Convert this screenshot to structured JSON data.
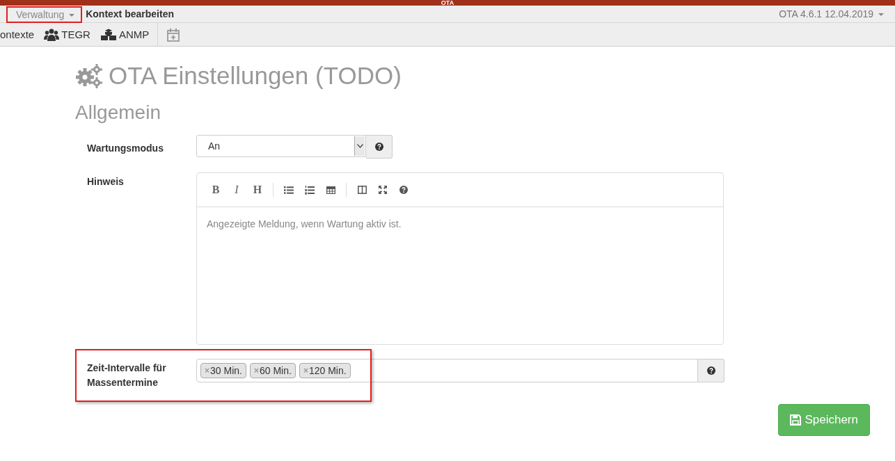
{
  "app_bar": {
    "title": "OTA"
  },
  "navbar": {
    "menu": "Verwaltung",
    "page_title": "Kontext bearbeiten",
    "version": "OTA 4.6.1 12.04.2019"
  },
  "toolbar": {
    "items": [
      {
        "kind": "text",
        "label": "ontexte"
      },
      {
        "kind": "users",
        "label": "TEGR"
      },
      {
        "kind": "cubes",
        "label": "ANMP"
      },
      {
        "kind": "calendar"
      }
    ]
  },
  "page": {
    "title": "OTA Einstellungen (TODO)",
    "section": "Allgemein"
  },
  "form": {
    "maintenance": {
      "label": "Wartungsmodus",
      "value": "An"
    },
    "notice": {
      "label": "Hinweis",
      "tools": [
        {
          "kind": "bold",
          "glyph": "B"
        },
        {
          "kind": "italic",
          "glyph": "I"
        },
        {
          "kind": "heading",
          "glyph": "H"
        },
        {
          "kind": "sep"
        },
        {
          "kind": "ul"
        },
        {
          "kind": "ol"
        },
        {
          "kind": "table"
        },
        {
          "kind": "sep"
        },
        {
          "kind": "side"
        },
        {
          "kind": "full"
        },
        {
          "kind": "help"
        }
      ],
      "placeholder": "Angezeigte Meldung, wenn Wartung aktiv ist."
    },
    "intervals": {
      "label": "Zeit-Intervalle für Massentermine",
      "tags": [
        {
          "remove": "×",
          "label": "30 Min."
        },
        {
          "remove": "×",
          "label": "60 Min."
        },
        {
          "remove": "×",
          "label": "120 Min."
        }
      ]
    }
  },
  "save_button": "Speichern"
}
